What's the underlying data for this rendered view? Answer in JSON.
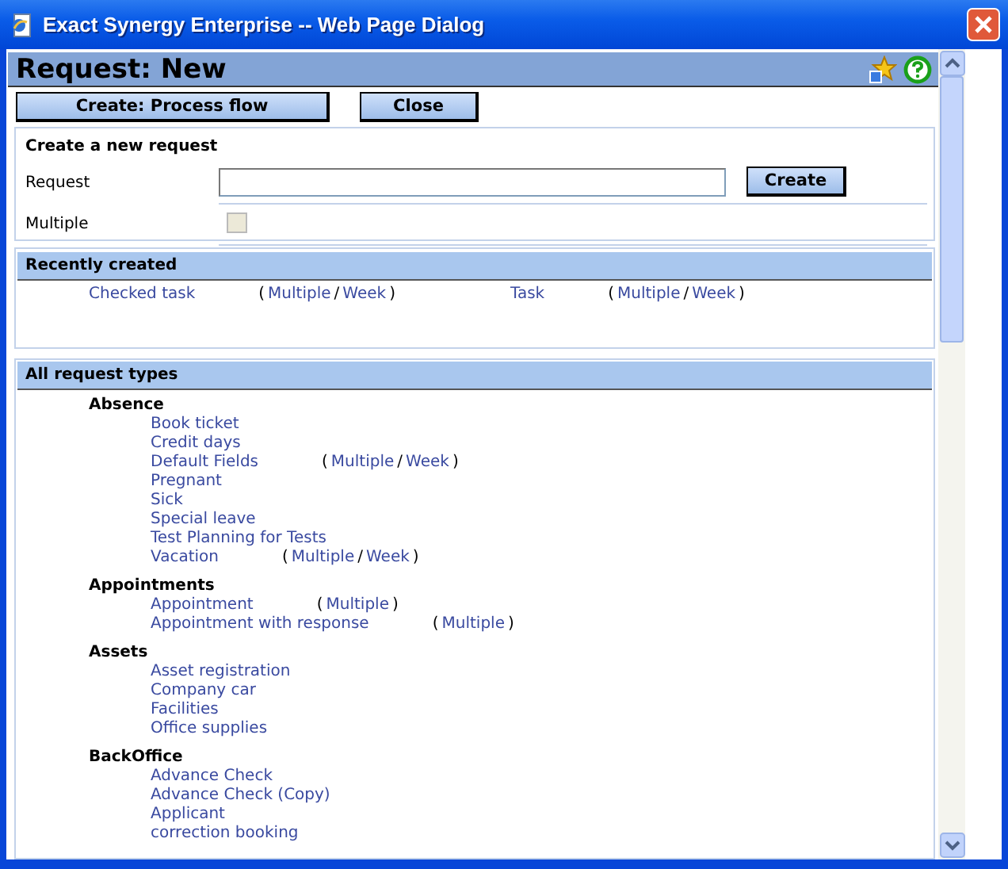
{
  "window": {
    "title": "Exact Synergy Enterprise -- Web Page Dialog"
  },
  "page": {
    "title": "Request: New"
  },
  "buttons": [
    {
      "label": "Create: Process flow",
      "kind": "wide"
    },
    {
      "label": "Close",
      "kind": "narrow"
    }
  ],
  "create_panel": {
    "heading": "Create a new request",
    "request_label": "Request",
    "create_button": "Create",
    "multiple_label": "Multiple",
    "multiple": {
      "checked": false,
      "disabled": true
    }
  },
  "recently_created": {
    "heading": "Recently created",
    "items": [
      {
        "name": "Checked task",
        "extras": [
          {
            "kind": "text",
            "text": "("
          },
          {
            "kind": "link",
            "text": "Multiple"
          },
          {
            "kind": "text",
            "text": "/"
          },
          {
            "kind": "link",
            "text": "Week"
          },
          {
            "kind": "text",
            "text": ")"
          }
        ]
      },
      {
        "name": "Task",
        "extras": [
          {
            "kind": "text",
            "text": "("
          },
          {
            "kind": "link",
            "text": "Multiple"
          },
          {
            "kind": "text",
            "text": "/"
          },
          {
            "kind": "link",
            "text": "Week"
          },
          {
            "kind": "text",
            "text": ")"
          }
        ]
      }
    ]
  },
  "all_request_types": {
    "heading": "All request types",
    "groups": [
      {
        "name": "Absence",
        "items": [
          {
            "name": "Book ticket"
          },
          {
            "name": "Credit days"
          },
          {
            "name": "Default Fields",
            "extras": [
              {
                "kind": "text",
                "text": "("
              },
              {
                "kind": "link",
                "text": "Multiple"
              },
              {
                "kind": "text",
                "text": "/"
              },
              {
                "kind": "link",
                "text": "Week"
              },
              {
                "kind": "text",
                "text": ")"
              }
            ]
          },
          {
            "name": "Pregnant"
          },
          {
            "name": "Sick"
          },
          {
            "name": "Special leave"
          },
          {
            "name": "Test Planning for Tests"
          },
          {
            "name": "Vacation",
            "extras": [
              {
                "kind": "text",
                "text": "("
              },
              {
                "kind": "link",
                "text": "Multiple"
              },
              {
                "kind": "text",
                "text": "/"
              },
              {
                "kind": "link",
                "text": "Week"
              },
              {
                "kind": "text",
                "text": ")"
              }
            ]
          }
        ]
      },
      {
        "name": "Appointments",
        "items": [
          {
            "name": "Appointment",
            "extras": [
              {
                "kind": "text",
                "text": "("
              },
              {
                "kind": "link",
                "text": "Multiple"
              },
              {
                "kind": "text",
                "text": ")"
              }
            ]
          },
          {
            "name": "Appointment with response",
            "extras": [
              {
                "kind": "text",
                "text": "("
              },
              {
                "kind": "link",
                "text": "Multiple"
              },
              {
                "kind": "text",
                "text": ")"
              }
            ]
          }
        ]
      },
      {
        "name": "Assets",
        "items": [
          {
            "name": "Asset registration"
          },
          {
            "name": "Company car"
          },
          {
            "name": "Facilities"
          },
          {
            "name": "Office supplies"
          }
        ]
      },
      {
        "name": "BackOffice",
        "items": [
          {
            "name": "Advance Check"
          },
          {
            "name": "Advance Check (Copy)"
          },
          {
            "name": "Applicant"
          },
          {
            "name": "correction booking"
          }
        ]
      }
    ]
  }
}
